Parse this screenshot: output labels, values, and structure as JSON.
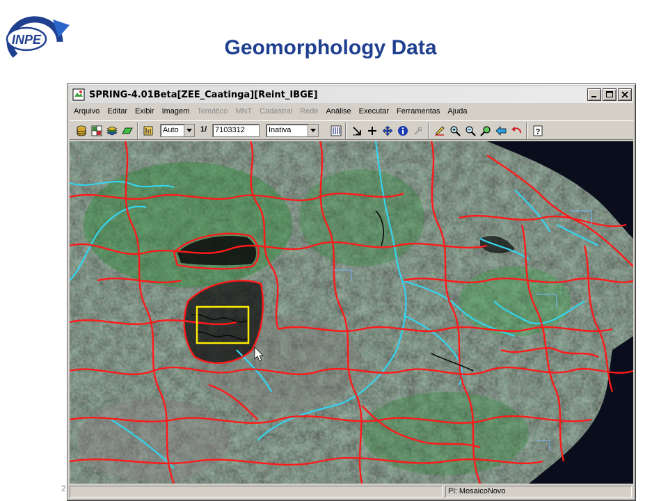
{
  "slide": {
    "title": "Geomorphology Data",
    "page_number": "2",
    "logo_text": "INPE"
  },
  "window": {
    "title": "SPRING-4.01Beta[ZEE_Caatinga][Reint_IBGE]",
    "controls": [
      "minimize",
      "maximize",
      "close"
    ]
  },
  "menu": {
    "items": [
      {
        "label": "Arquivo",
        "enabled": true
      },
      {
        "label": "Editar",
        "enabled": true
      },
      {
        "label": "Exibir",
        "enabled": true
      },
      {
        "label": "Imagem",
        "enabled": true
      },
      {
        "label": "Temático",
        "enabled": false
      },
      {
        "label": "MNT",
        "enabled": false
      },
      {
        "label": "Cadastral",
        "enabled": false
      },
      {
        "label": "Rede",
        "enabled": false
      },
      {
        "label": "Análise",
        "enabled": true
      },
      {
        "label": "Executar",
        "enabled": true
      },
      {
        "label": "Ferramentas",
        "enabled": true
      },
      {
        "label": "Ajuda",
        "enabled": true
      }
    ]
  },
  "toolbar": {
    "scale_mode": "Auto",
    "scale_prefix": "1/",
    "scale_value": "7103312",
    "mode_select": "Inativa"
  },
  "status": {
    "plane": "Pl: MosaicoNovo"
  },
  "colors": {
    "title": "#1f3f8f",
    "boundaries": "#ff1a1a",
    "rivers": "#33d6f0",
    "selection": "#ffee00",
    "relief": "#0a0a0a"
  }
}
